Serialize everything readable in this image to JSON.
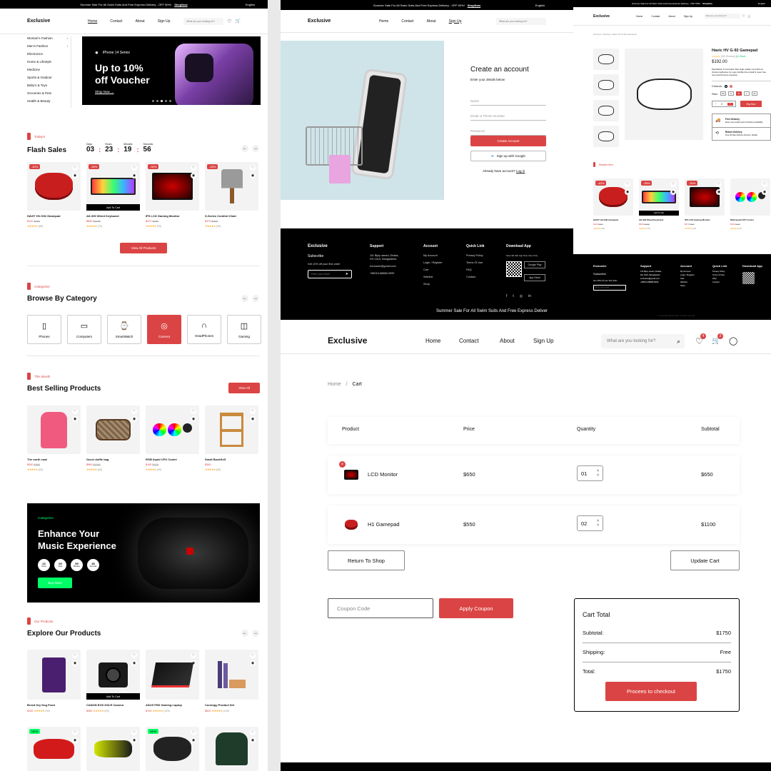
{
  "home": {
    "topbar": {
      "promo": "Summer Sale For All Swim Suits And Free Express Delivery - OFF 50%!",
      "shop": "ShopNow",
      "lang": "English"
    },
    "logo": "Exclusive",
    "nav": [
      "Home",
      "Contact",
      "About",
      "Sign Up"
    ],
    "search_placeholder": "What are you looking for?",
    "sidebar": [
      "Woman's Fashion",
      "Men's Fashion",
      "Electronics",
      "Home & Lifestyle",
      "Medicine",
      "Sports & Outdoor",
      "Baby's & Toys",
      "Groceries & Pets",
      "Health & Beauty"
    ],
    "hero": {
      "series": "iPhone 14 Series",
      "title1": "Up to 10%",
      "title2": "off Voucher",
      "cta": "Shop Now"
    },
    "today_tag": "Today's",
    "flash_title": "Flash Sales",
    "countdown": [
      {
        "label": "Days",
        "value": "03"
      },
      {
        "label": "Hours",
        "value": "23"
      },
      {
        "label": "Minutes",
        "value": "19"
      },
      {
        "label": "Seconds",
        "value": "56"
      }
    ],
    "flash_products": [
      {
        "badge": "-40%",
        "name": "HAVIT HV-G92 Gamepad",
        "price": "$120",
        "old": "$160",
        "reviews": "(88)",
        "img": "gamepad-red"
      },
      {
        "badge": "-35%",
        "name": "AK-900 Wired Keyboard",
        "price": "$960",
        "old": "$1160",
        "reviews": "(75)",
        "img": "keyboard",
        "cart": "Add To Cart"
      },
      {
        "badge": "-30%",
        "name": "IPS LCD Gaming Monitor",
        "price": "$370",
        "old": "$400",
        "reviews": "(99)",
        "img": "monitor"
      },
      {
        "badge": "-25%",
        "name": "S-Series Comfort Chair",
        "price": "$375",
        "old": "$400",
        "reviews": "(99)",
        "img": "chair"
      }
    ],
    "view_all": "View All Products",
    "cat_tag": "Categories",
    "cat_title": "Browse By Category",
    "categories": [
      {
        "label": "Phones",
        "icon": "phone-icon"
      },
      {
        "label": "Computers",
        "icon": "computer-icon"
      },
      {
        "label": "SmartWatch",
        "icon": "watch-icon"
      },
      {
        "label": "Camera",
        "icon": "camera-icon",
        "active": true
      },
      {
        "label": "HeadPhones",
        "icon": "headphones-icon"
      },
      {
        "label": "Gaming",
        "icon": "gamepad-icon"
      }
    ],
    "month_tag": "This Month",
    "best_title": "Best Selling Products",
    "best_view_all": "View All",
    "best_products": [
      {
        "name": "The north coat",
        "price": "$260",
        "old": "$360",
        "reviews": "(65)",
        "img": "coat"
      },
      {
        "name": "Gucci duffle bag",
        "price": "$960",
        "old": "$1160",
        "reviews": "(65)",
        "img": "bag"
      },
      {
        "name": "RGB liquid CPU Cooler",
        "price": "$160",
        "old": "$170",
        "reviews": "(65)",
        "img": "cooler"
      },
      {
        "name": "Small BookSelf",
        "price": "$360",
        "old": "",
        "reviews": "(65)",
        "img": "shelf"
      }
    ],
    "banner": {
      "tag": "Categories",
      "title1": "Enhance Your",
      "title2": "Music Experience",
      "timer": [
        {
          "v": "23",
          "l": "Hours"
        },
        {
          "v": "05",
          "l": "Days"
        },
        {
          "v": "59",
          "l": "Minutes"
        },
        {
          "v": "35",
          "l": "Seconds"
        }
      ],
      "cta": "Buy Now!"
    },
    "our_tag": "Our Products",
    "explore_title": "Explore Our Products",
    "explore_products": [
      {
        "name": "Breed Dry Dog Food",
        "price": "$100",
        "reviews": "(35)",
        "img": "dogfood"
      },
      {
        "name": "CANON EOS DSLR Camera",
        "price": "$360",
        "reviews": "(95)",
        "img": "camera",
        "cart": "Add To Cart"
      },
      {
        "name": "ASUS FHD Gaming Laptop",
        "price": "$700",
        "reviews": "(325)",
        "img": "laptop"
      },
      {
        "name": "Curology Product Set",
        "price": "$500",
        "reviews": "(145)",
        "img": "curology"
      }
    ],
    "explore_row2": [
      {
        "img": "car",
        "badge": "NEW"
      },
      {
        "img": "boots"
      },
      {
        "img": "gamepad-black",
        "badge": "NEW"
      },
      {
        "img": "jacket"
      }
    ]
  },
  "signup": {
    "topbar": "Summer Sale For All Swim Suits And Free Express Delivery - OFF 50%!",
    "shop": "ShopNow",
    "lang": "English",
    "logo": "Exclusive",
    "nav": [
      "Home",
      "Contact",
      "About",
      "Sign Up"
    ],
    "search": "What are you looking for?",
    "title": "Create an account",
    "subtitle": "Enter your details below",
    "fields": [
      "Name",
      "Email or Phone Number",
      "Password"
    ],
    "create": "Create Account",
    "google": "Sign up with Google",
    "have": "Already have account?",
    "login": "Log in"
  },
  "footer": {
    "brand": "Exclusive",
    "subscribe": "Subscribe",
    "offer": "Get 10% off your first order",
    "email_ph": "Enter your email",
    "support": {
      "title": "Support",
      "lines": [
        "111 Bijoy sarani, Dhaka,",
        "DH 1515, Bangladesh.",
        "exclusive@gmail.com",
        "+88015-88888-9999"
      ]
    },
    "account": {
      "title": "Account",
      "links": [
        "My Account",
        "Login / Register",
        "Cart",
        "Wishlist",
        "Shop"
      ]
    },
    "quick": {
      "title": "Quick Link",
      "links": [
        "Privacy Policy",
        "Terms Of Use",
        "FAQ",
        "Contact"
      ]
    },
    "app": {
      "title": "Download App",
      "note": "Save $3 with App New User Only",
      "google": "Google Play",
      "apple": "App Store"
    },
    "marquee": "Summer Sale For All Swim Suits And Free Express Deliver"
  },
  "detail": {
    "topbar": "Summer Sale For All Swim Suits And Free Express Delivery - OFF 50%!",
    "shop": "ShopNow",
    "lang": "English",
    "logo": "Exclusive",
    "nav": [
      "Home",
      "Contact",
      "About",
      "Sign Up"
    ],
    "search": "What are you looking for?",
    "breadcrumb": "Account  /  Gaming  /  Havic HV G-92 Gamepad",
    "name": "Havic HV G-92 Gamepad",
    "reviews": "(150 Reviews)",
    "stock": "In Stock",
    "price": "$192.00",
    "desc": "PlayStation 5 Controller Skin High quality vinyl with air channel adhesive for easy bubble free install & mess free removal Pressure sensitive.",
    "colours": "Colours:",
    "size": "Size:",
    "sizes": [
      "XS",
      "S",
      "M",
      "L",
      "XL"
    ],
    "qty": "2",
    "buy": "Buy Now",
    "delivery": "Free Delivery",
    "delivery_note": "Enter your postal code for Delivery Availability",
    "return": "Return Delivery",
    "return_note": "Free 30 Days Delivery Returns. Details",
    "related_tag": "Related Item",
    "related": [
      {
        "badge": "-40%",
        "name": "HAVIT HV-G92 Gamepad",
        "price": "$120",
        "old": "$160",
        "reviews": "(88)",
        "img": "gamepad-red"
      },
      {
        "badge": "-35%",
        "name": "AK-900 Wired Keyboard",
        "price": "$960",
        "old": "$1160",
        "reviews": "(75)",
        "img": "keyboard",
        "cart": "Add To Cart"
      },
      {
        "badge": "-30%",
        "name": "IPS LCD Gaming Monitor",
        "price": "$370",
        "old": "$400",
        "reviews": "(99)",
        "img": "monitor"
      },
      {
        "name": "RGB liquid CPU Cooler",
        "price": "$160",
        "old": "$170",
        "reviews": "(65)",
        "img": "cooler"
      }
    ],
    "copyright": "© Copyright Rimel 2022. All right reserved"
  },
  "cart": {
    "logo": "Exclusive",
    "nav": [
      "Home",
      "Contact",
      "About",
      "Sign Up"
    ],
    "search": "What are you looking for?",
    "wish_count": "4",
    "cart_count": "2",
    "crumb_home": "Home",
    "crumb_cur": "Cart",
    "headers": [
      "Product",
      "Price",
      "Quantity",
      "Subtotal"
    ],
    "items": [
      {
        "name": "LCD Monitor",
        "price": "$650",
        "qty": "01",
        "subtotal": "$650",
        "img": "monitor"
      },
      {
        "name": "H1 Gamepad",
        "price": "$550",
        "qty": "02",
        "subtotal": "$1100",
        "img": "gamepad-red"
      }
    ],
    "return": "Return To Shop",
    "update": "Update Cart",
    "coupon_ph": "Coupon Code",
    "apply": "Apply Coupon",
    "total": {
      "title": "Cart Total",
      "subtotal_label": "Subtotal:",
      "subtotal": "$1750",
      "shipping_label": "Shipping:",
      "shipping": "Free",
      "total_label": "Total:",
      "total": "$1750",
      "checkout": "Procees to checkout"
    }
  }
}
